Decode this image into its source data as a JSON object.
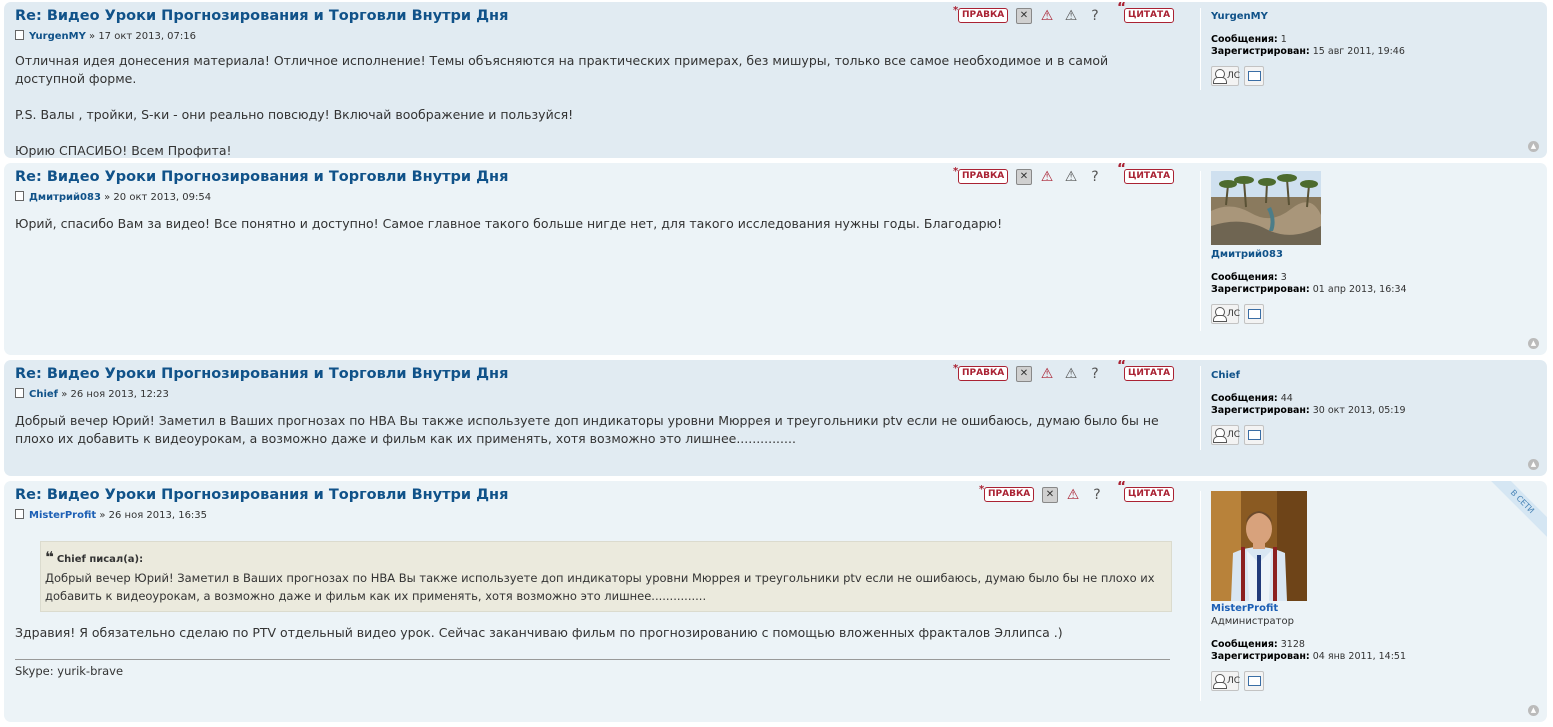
{
  "buttons": {
    "edit": "ПРАВКА",
    "quote": "ЦИТАТА",
    "pm": "ЛС"
  },
  "icons": [
    "delete-icon",
    "warn-icon",
    "report-icon",
    "info-icon",
    "top-icon",
    "email-icon"
  ],
  "posts": [
    {
      "title": "Re: Видео Уроки Прогнозирования и Торговли Внутри Дня",
      "author": "YurgenMY",
      "date": "» 17 окт 2013, 07:16",
      "lines": [
        "Отличная идея донесения материала! Отличное исполнение! Темы объясняются на практических примерах, без мишуры, только все самое необходимое и в самой доступной форме.",
        "P.S. Валы , тройки, S-ки - они реально повсюду! Включай воображение и пользуйся!",
        "Юрию СПАСИБО! Всем Профита!"
      ],
      "profile": {
        "name": "YurgenMY",
        "posts_label": "Сообщения:",
        "posts": "1",
        "reg_label": "Зарегистрирован:",
        "reg": "15 авг 2011, 19:46"
      }
    },
    {
      "title": "Re: Видео Уроки Прогнозирования и Торговли Внутри Дня",
      "author": "Дмитрий083",
      "date": "» 20 окт 2013, 09:54",
      "lines": [
        "Юрий, спасибо Вам за видео! Все понятно и доступно! Самое главное такого больше нигде нет, для такого исследования нужны годы. Благодарю!"
      ],
      "profile": {
        "name": "Дмитрий083",
        "posts_label": "Сообщения:",
        "posts": "3",
        "reg_label": "Зарегистрирован:",
        "reg": "01 апр 2013, 16:34"
      }
    },
    {
      "title": "Re: Видео Уроки Прогнозирования и Торговли Внутри Дня",
      "author": "Chief",
      "date": "» 26 ноя 2013, 12:23",
      "lines": [
        "Добрый вечер Юрий! Заметил в Ваших прогнозах по НВА Вы также используете доп индикаторы уровни Мюррея и треугольники ptv если не ошибаюсь, думаю было бы не плохо их добавить к видеоурокам, а возможно даже и фильм как их применять, хотя возможно это лишнее..............."
      ],
      "profile": {
        "name": "Chief",
        "posts_label": "Сообщения:",
        "posts": "44",
        "reg_label": "Зарегистрирован:",
        "reg": "30 окт 2013, 05:19"
      }
    },
    {
      "title": "Re: Видео Уроки Прогнозирования и Торговли Внутри Дня",
      "author": "MisterProfit",
      "date": "» 26 ноя 2013, 16:35",
      "quote_cite": "Chief писал(а):",
      "quote_text": "Добрый вечер Юрий! Заметил в Ваших прогнозах по НВА Вы также используете доп индикаторы уровни Мюррея и треугольники ptv если не ошибаюсь, думаю было бы не плохо их добавить к видеоурокам, а возможно даже и фильм как их применять, хотя возможно это лишнее...............",
      "lines": [
        "Здравия! Я обязательно сделаю по PTV отдельный видео урок. Сейчас заканчиваю фильм по прогнозированию с помощью вложенных фракталов Эллипса .)"
      ],
      "signature": "Skype: yurik-brave",
      "online": "В СЕТИ",
      "profile": {
        "name": "MisterProfit",
        "rank": "Администратор",
        "posts_label": "Сообщения:",
        "posts": "3128",
        "reg_label": "Зарегистрирован:",
        "reg": "04 янв 2011, 14:51"
      }
    }
  ]
}
